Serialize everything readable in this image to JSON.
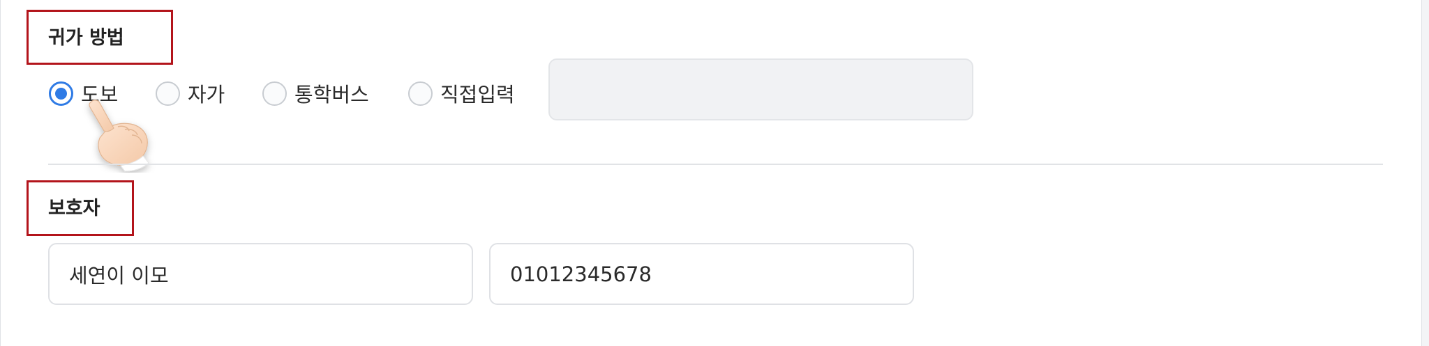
{
  "return_method": {
    "title": "귀가 방법",
    "options": [
      {
        "label": "도보",
        "checked": true
      },
      {
        "label": "자가",
        "checked": false
      },
      {
        "label": "통학버스",
        "checked": false
      },
      {
        "label": "직접입력",
        "checked": false
      }
    ],
    "direct_input_value": ""
  },
  "guardian": {
    "title": "보호자",
    "name_value": "세연이 이모",
    "phone_value": "01012345678"
  },
  "colors": {
    "annotation": "#b3141b",
    "accent": "#2f7be5"
  },
  "icons": {
    "pointer": "hand-pointer-icon"
  }
}
